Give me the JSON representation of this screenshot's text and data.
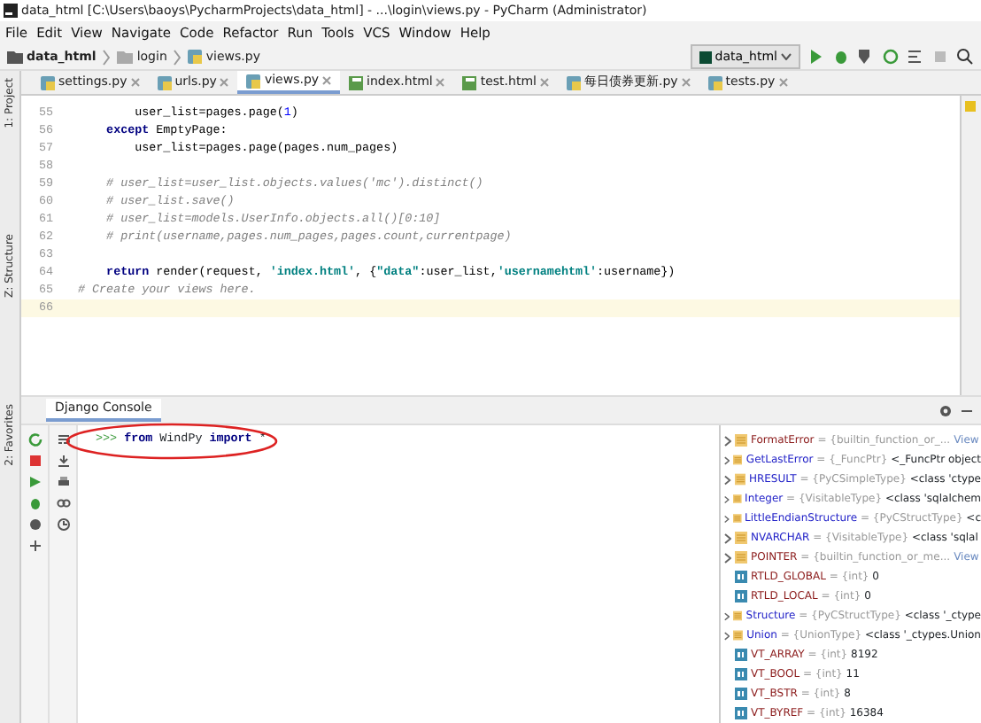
{
  "window": {
    "title": "data_html [C:\\Users\\baoys\\PycharmProjects\\data_html] - ...\\login\\views.py - PyCharm (Administrator)"
  },
  "menu": [
    "File",
    "Edit",
    "View",
    "Navigate",
    "Code",
    "Refactor",
    "Run",
    "Tools",
    "VCS",
    "Window",
    "Help"
  ],
  "breadcrumb": [
    "data_html",
    "login",
    "views.py"
  ],
  "run_config": "data_html",
  "tabs": [
    {
      "label": "settings.py",
      "selected": false,
      "kind": "py"
    },
    {
      "label": "urls.py",
      "selected": false,
      "kind": "py"
    },
    {
      "label": "views.py",
      "selected": true,
      "kind": "py"
    },
    {
      "label": "index.html",
      "selected": false,
      "kind": "html"
    },
    {
      "label": "test.html",
      "selected": false,
      "kind": "html"
    },
    {
      "label": "每日债券更新.py",
      "selected": false,
      "kind": "py"
    },
    {
      "label": "tests.py",
      "selected": false,
      "kind": "py"
    }
  ],
  "left_tool_tabs": [
    "1: Project",
    "Z: Structure",
    "2: Favorites"
  ],
  "editor": {
    "lines": [
      {
        "number": "55",
        "current": false,
        "tokens": [
          {
            "kind": "plain",
            "text": "        user_list=pages.page("
          },
          {
            "kind": "num",
            "text": "1"
          },
          {
            "kind": "plain",
            "text": ")"
          }
        ]
      },
      {
        "number": "56",
        "current": false,
        "tokens": [
          {
            "kind": "kw",
            "text": "    except"
          },
          {
            "kind": "plain",
            "text": " EmptyPage:"
          }
        ]
      },
      {
        "number": "57",
        "current": false,
        "tokens": [
          {
            "kind": "plain",
            "text": "        user_list=pages.page(pages.num_pages)"
          }
        ]
      },
      {
        "number": "58",
        "current": false
      },
      {
        "number": "59",
        "current": false,
        "tokens": [
          {
            "kind": "cmt",
            "text": "    # user_list=user_list.objects.values('mc').distinct()"
          }
        ]
      },
      {
        "number": "60",
        "current": false,
        "tokens": [
          {
            "kind": "cmt",
            "text": "    # user_list.save()"
          }
        ]
      },
      {
        "number": "61",
        "current": false,
        "tokens": [
          {
            "kind": "cmt",
            "text": "    # user_list=models.UserInfo.objects.all()[0:10]"
          }
        ]
      },
      {
        "number": "62",
        "current": false,
        "tokens": [
          {
            "kind": "cmt",
            "text": "    # print(username,pages.num_pages,pages.count,currentpage)"
          }
        ]
      },
      {
        "number": "63",
        "current": false
      },
      {
        "number": "64",
        "current": false,
        "tokens": [
          {
            "kind": "kw",
            "text": "    return"
          },
          {
            "kind": "plain",
            "text": " render(request, "
          },
          {
            "kind": "str",
            "text": "'index.html'"
          },
          {
            "kind": "plain",
            "text": ", {"
          },
          {
            "kind": "str",
            "text": "\"data\""
          },
          {
            "kind": "plain",
            "text": ":user_list,"
          },
          {
            "kind": "str",
            "text": "'usernamehtml'"
          },
          {
            "kind": "plain",
            "text": ":username})"
          }
        ]
      },
      {
        "number": "65",
        "current": false,
        "tokens": [
          {
            "kind": "cmt",
            "text": "# Create your views here."
          }
        ]
      },
      {
        "number": "66",
        "current": true
      }
    ]
  },
  "console": {
    "tab": "Django Console",
    "prompt": ">>>",
    "input": [
      {
        "kind": "kw",
        "text": "from"
      },
      {
        "kind": "plain",
        "text": " WindPy "
      },
      {
        "kind": "kw",
        "text": "import"
      },
      {
        "kind": "plain",
        "text": " *"
      }
    ]
  },
  "variables": [
    {
      "kind": "class",
      "name": "FormatError",
      "color": "#8b1a1a",
      "type": "= {builtin_function_or_...",
      "link": "View"
    },
    {
      "kind": "class",
      "name": "GetLastError",
      "color": "#2323c8",
      "type": "= {_FuncPtr}",
      "value": "<_FuncPtr object"
    },
    {
      "kind": "class",
      "name": "HRESULT",
      "color": "#2323c8",
      "type": "= {PyCSimpleType}",
      "value": "<class 'ctype"
    },
    {
      "kind": "class",
      "name": "Integer",
      "color": "#2323c8",
      "type": "= {VisitableType}",
      "value": "<class 'sqlalchem"
    },
    {
      "kind": "class",
      "name": "LittleEndianStructure",
      "color": "#2323c8",
      "type": "= {PyCStructType}",
      "value": "<c"
    },
    {
      "kind": "class",
      "name": "NVARCHAR",
      "color": "#2323c8",
      "type": "= {VisitableType}",
      "value": "<class 'sqlal"
    },
    {
      "kind": "class",
      "name": "POINTER",
      "color": "#8b1a1a",
      "type": "= {builtin_function_or_me...",
      "link": "View"
    },
    {
      "kind": "int",
      "name": "RTLD_GLOBAL",
      "color": "#8b1a1a",
      "type": "= {int}",
      "value": "0"
    },
    {
      "kind": "int",
      "name": "RTLD_LOCAL",
      "color": "#8b1a1a",
      "type": "= {int}",
      "value": "0"
    },
    {
      "kind": "class",
      "name": "Structure",
      "color": "#2323c8",
      "type": "= {PyCStructType}",
      "value": "<class '_ctype"
    },
    {
      "kind": "class",
      "name": "Union",
      "color": "#2323c8",
      "type": "= {UnionType}",
      "value": "<class '_ctypes.Union"
    },
    {
      "kind": "int",
      "name": "VT_ARRAY",
      "color": "#8b1a1a",
      "type": "= {int}",
      "value": "8192"
    },
    {
      "kind": "int",
      "name": "VT_BOOL",
      "color": "#8b1a1a",
      "type": "= {int}",
      "value": "11"
    },
    {
      "kind": "int",
      "name": "VT_BSTR",
      "color": "#8b1a1a",
      "type": "= {int}",
      "value": "8"
    },
    {
      "kind": "int",
      "name": "VT_BYREF",
      "color": "#8b1a1a",
      "type": "= {int}",
      "value": "16384"
    }
  ]
}
